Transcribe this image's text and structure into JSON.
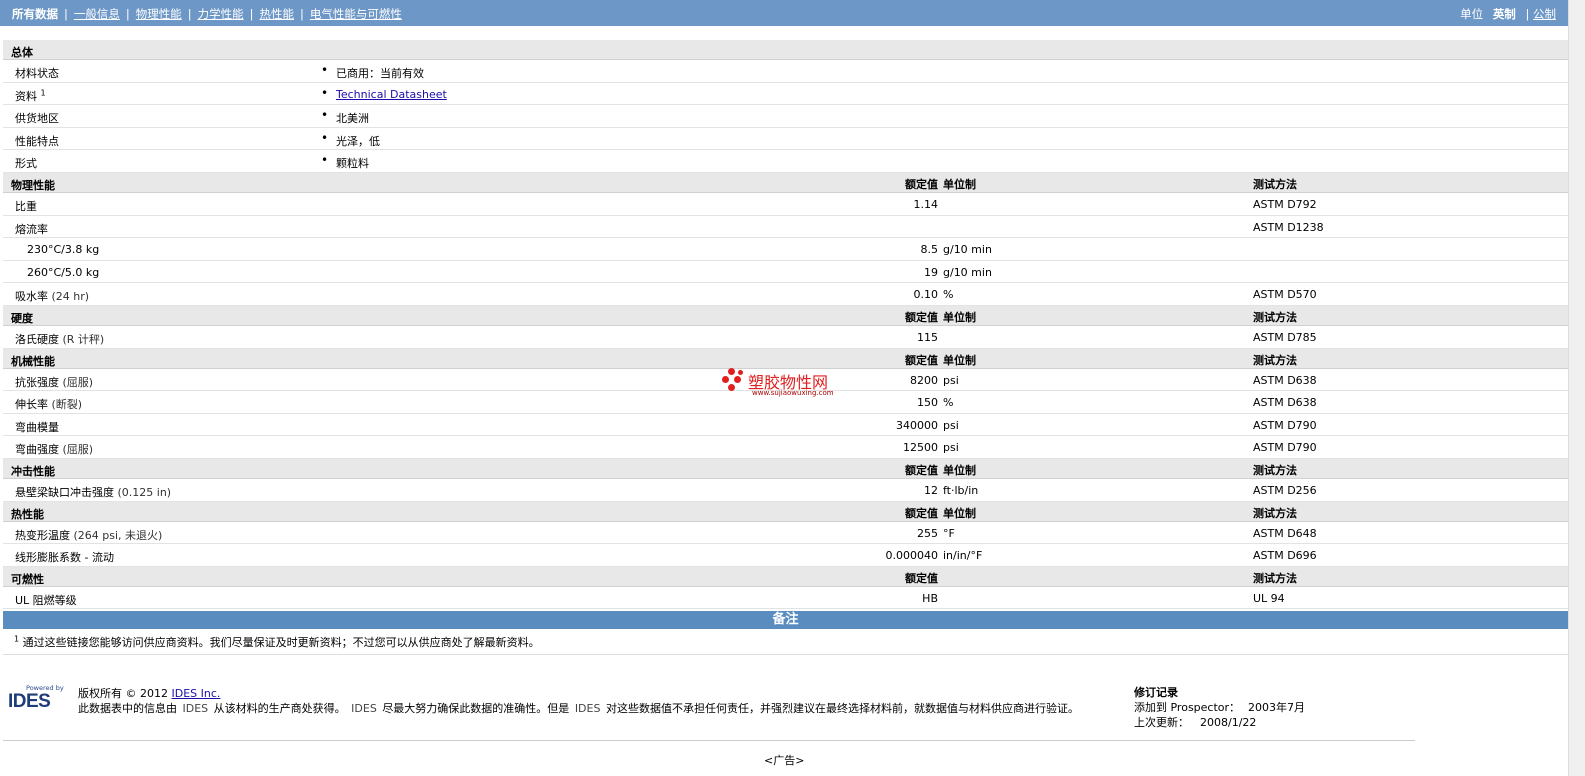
{
  "nav": {
    "items": [
      "所有数据",
      "一般信息",
      "物理性能",
      "力学性能",
      "热性能",
      "电气性能与可燃性"
    ],
    "units_label": "单位",
    "units_active": "英制",
    "units_alt": "公制"
  },
  "general": {
    "title": "总体",
    "rows": [
      {
        "label": "材料状态",
        "value": "已商用：当前有效"
      },
      {
        "label": "资料",
        "sup": "1",
        "link": "Technical Datasheet"
      },
      {
        "label": "供货地区",
        "value": "北美洲"
      },
      {
        "label": "性能特点",
        "value": "光泽，低"
      },
      {
        "label": "形式",
        "value": "颗粒料"
      }
    ]
  },
  "headers": {
    "value": "额定值",
    "unit": "单位制",
    "test": "测试方法"
  },
  "physical": {
    "title": "物理性能",
    "rows": [
      {
        "label": "比重",
        "value": "1.14",
        "unit": "",
        "test": "ASTM D792"
      },
      {
        "label": "熔流率",
        "value": "",
        "unit": "",
        "test": "ASTM D1238"
      },
      {
        "label": "230°C/3.8 kg",
        "value": "8.5",
        "unit": "g/10 min",
        "test": ""
      },
      {
        "label": "260°C/5.0 kg",
        "value": "19",
        "unit": "g/10 min",
        "test": ""
      },
      {
        "label": "吸水率",
        "paren": "(24 hr)",
        "value": "0.10",
        "unit": "%",
        "test": "ASTM D570"
      }
    ]
  },
  "hardness": {
    "title": "硬度",
    "rows": [
      {
        "label": "洛氏硬度",
        "paren": "(R 计秤)",
        "value": "115",
        "unit": "",
        "test": "ASTM D785"
      }
    ]
  },
  "mechanical": {
    "title": "机械性能",
    "rows": [
      {
        "label": "抗张强度",
        "paren": "(屈服)",
        "value": "8200",
        "unit": "psi",
        "test": "ASTM D638"
      },
      {
        "label": "伸长率",
        "paren": "(断裂)",
        "value": "150",
        "unit": "%",
        "test": "ASTM D638"
      },
      {
        "label": "弯曲模量",
        "value": "340000",
        "unit": "psi",
        "test": "ASTM D790"
      },
      {
        "label": "弯曲强度",
        "paren": "(屈服)",
        "value": "12500",
        "unit": "psi",
        "test": "ASTM D790"
      }
    ]
  },
  "impact": {
    "title": "冲击性能",
    "rows": [
      {
        "label": "悬壁梁缺口冲击强度",
        "paren": "(0.125 in)",
        "value": "12",
        "unit": "ft·lb/in",
        "test": "ASTM D256"
      }
    ]
  },
  "thermal": {
    "title": "热性能",
    "rows": [
      {
        "label": "热变形温度",
        "paren": "(264 psi, 未退火)",
        "value": "255",
        "unit": "°F",
        "test": "ASTM D648"
      },
      {
        "label": "线形膨胀系数 - 流动",
        "value": "0.000040",
        "unit": "in/in/°F",
        "test": "ASTM D696"
      }
    ]
  },
  "flammability": {
    "title": "可燃性",
    "rows": [
      {
        "label": "UL 阻燃等级",
        "value": "HB",
        "unit": "",
        "test": "UL 94"
      }
    ]
  },
  "notes": {
    "title": "备注",
    "sup": "1",
    "text": "通过这些链接您能够访问供应商资料。我们尽量保证及时更新资料；不过您可以从供应商处了解最新资料。"
  },
  "footer": {
    "powered_by": "Powered by",
    "brand": "IDES",
    "copyright": "版权所有 © 2012",
    "copyright_link": "IDES Inc.",
    "disclaimer_1": "此数据表中的信息由",
    "ides_1": "IDES",
    "disclaimer_2": "从该材料的生产商处获得。",
    "ides_2": "IDES",
    "disclaimer_3": "尽最大努力确保此数据的准确性。但是",
    "ides_3": "IDES",
    "disclaimer_4": "对这些数据值不承担任何责任，并强烈建议在最终选择材料前，就数据值与材料供应商进行验证。",
    "rev_title": "修订记录",
    "added_label": "添加到 Prospector：",
    "added_value": "2003年7月",
    "updated_label": "上次更新：",
    "updated_value": "2008/1/22",
    "ad": "<广告>"
  },
  "watermark": {
    "text": "塑胶物性网",
    "url": "www.sujiaowuxing.com"
  }
}
